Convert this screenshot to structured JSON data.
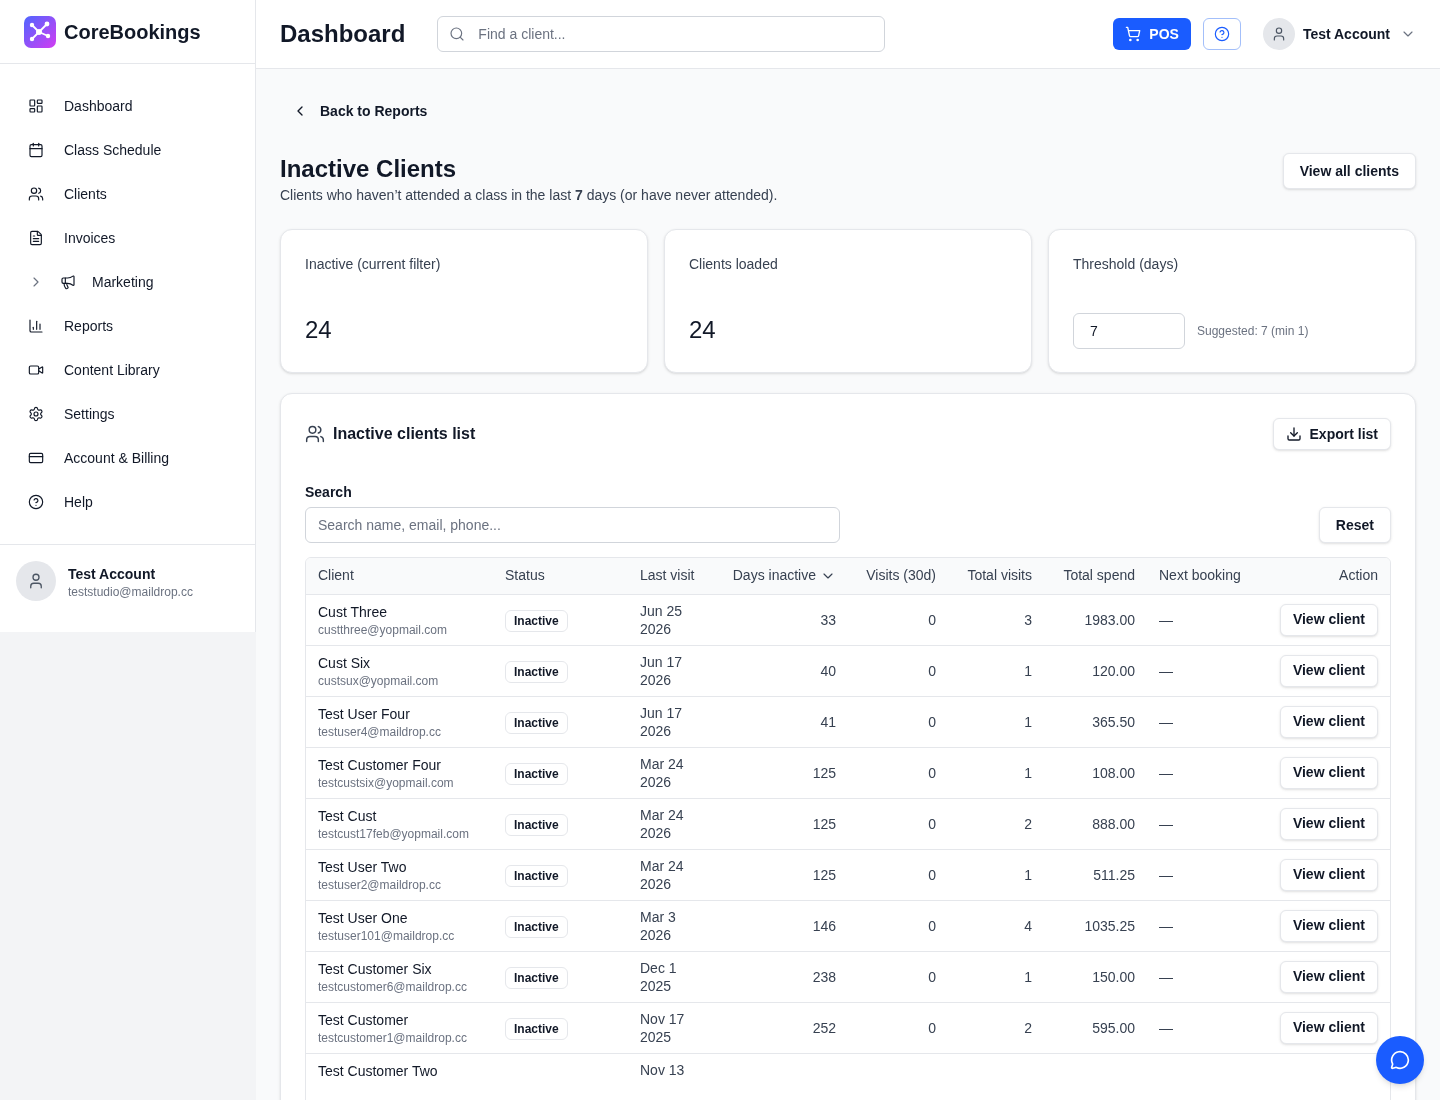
{
  "sidebar": {
    "brand": "CoreBookings",
    "items": [
      {
        "label": "Dashboard",
        "kind": "link",
        "selected": false
      },
      {
        "label": "Class Schedule",
        "kind": "link",
        "selected": false
      },
      {
        "label": "Clients",
        "kind": "link",
        "selected": false
      },
      {
        "label": "Invoices",
        "kind": "link",
        "selected": false
      },
      {
        "label": "Marketing",
        "kind": "group",
        "expanded": false,
        "selected": false
      },
      {
        "label": "Reports",
        "kind": "link",
        "selected": false
      },
      {
        "label": "Content Library",
        "kind": "link",
        "selected": false
      },
      {
        "label": "Settings",
        "kind": "link",
        "selected": false
      },
      {
        "label": "Account & Billing",
        "kind": "link",
        "selected": false
      },
      {
        "label": "Help",
        "kind": "link",
        "selected": false
      }
    ],
    "account": {
      "name": "Test Account",
      "email": "teststudio@maildrop.cc"
    }
  },
  "top_bar": {
    "title": "Dashboard",
    "search": {
      "placeholder": "Find a client..."
    },
    "pos_button": "POS",
    "account": {
      "name": "Test Account"
    }
  },
  "page": {
    "back_link": "Back to Reports",
    "title": "Inactive Clients",
    "subtitle": "Clients who haven’t attended a class in the last **7** days (or have never attended).",
    "view_all_button": "View all clients"
  },
  "stats": [
    {
      "kind": "value",
      "label": "Inactive (current filter)",
      "value": "24"
    },
    {
      "kind": "value",
      "label": "Clients loaded",
      "value": "24"
    },
    {
      "kind": "input",
      "label": "Threshold (days)",
      "value": "7",
      "hint": "Suggested: 7 (min 1)"
    }
  ],
  "clients_list": {
    "title": "Inactive clients list",
    "export_button": "Export list",
    "search": {
      "label": "Search",
      "placeholder": "Search name, email, phone..."
    },
    "reset_button": "Reset",
    "columns": [
      {
        "label": "Client",
        "sorted": false
      },
      {
        "label": "Status",
        "sorted": false
      },
      {
        "label": "Last visit",
        "sorted": false
      },
      {
        "label": "Days inactive",
        "sorted": true
      },
      {
        "label": "Visits (30d)",
        "sorted": false
      },
      {
        "label": "Total visits",
        "sorted": false
      },
      {
        "label": "Total spend",
        "sorted": false
      },
      {
        "label": "Next booking",
        "sorted": false
      },
      {
        "label": "Action",
        "sorted": false
      }
    ],
    "rows": [
      {
        "client": "Cust Three",
        "email": "custthree@yopmail.com",
        "status": "Inactive",
        "last_visit": "Jun 25 2026",
        "days_inactive": "33",
        "visits_30d": "0",
        "total_visits": "3",
        "total_spend": "1983.00",
        "next_booking": "—",
        "action": "View client"
      },
      {
        "client": "Cust Six",
        "email": "custsux@yopmail.com",
        "status": "Inactive",
        "last_visit": "Jun 17 2026",
        "days_inactive": "40",
        "visits_30d": "0",
        "total_visits": "1",
        "total_spend": "120.00",
        "next_booking": "—",
        "action": "View client"
      },
      {
        "client": "Test User Four",
        "email": "testuser4@maildrop.cc",
        "status": "Inactive",
        "last_visit": "Jun 17 2026",
        "days_inactive": "41",
        "visits_30d": "0",
        "total_visits": "1",
        "total_spend": "365.50",
        "next_booking": "—",
        "action": "View client"
      },
      {
        "client": "Test Customer Four",
        "email": "testcustsix@yopmail.com",
        "status": "Inactive",
        "last_visit": "Mar 24 2026",
        "days_inactive": "125",
        "visits_30d": "0",
        "total_visits": "1",
        "total_spend": "108.00",
        "next_booking": "—",
        "action": "View client"
      },
      {
        "client": "Test Cust",
        "email": "testcust17feb@yopmail.com",
        "status": "Inactive",
        "last_visit": "Mar 24 2026",
        "days_inactive": "125",
        "visits_30d": "0",
        "total_visits": "2",
        "total_spend": "888.00",
        "next_booking": "—",
        "action": "View client"
      },
      {
        "client": "Test User Two",
        "email": "testuser2@maildrop.cc",
        "status": "Inactive",
        "last_visit": "Mar 24 2026",
        "days_inactive": "125",
        "visits_30d": "0",
        "total_visits": "1",
        "total_spend": "511.25",
        "next_booking": "—",
        "action": "View client"
      },
      {
        "client": "Test User One",
        "email": "testuser101@maildrop.cc",
        "status": "Inactive",
        "last_visit": "Mar 3 2026",
        "days_inactive": "146",
        "visits_30d": "0",
        "total_visits": "4",
        "total_spend": "1035.25",
        "next_booking": "—",
        "action": "View client"
      },
      {
        "client": "Test Customer Six",
        "email": "testcustomer6@maildrop.cc",
        "status": "Inactive",
        "last_visit": "Dec 1 2025",
        "days_inactive": "238",
        "visits_30d": "0",
        "total_visits": "1",
        "total_spend": "150.00",
        "next_booking": "—",
        "action": "View client"
      },
      {
        "client": "Test Customer",
        "email": "testcustomer1@maildrop.cc",
        "status": "Inactive",
        "last_visit": "Nov 17 2025",
        "days_inactive": "252",
        "visits_30d": "0",
        "total_visits": "2",
        "total_spend": "595.00",
        "next_booking": "—",
        "action": "View client"
      },
      {
        "client": "Test Customer Two",
        "last_visit": "Nov 13"
      }
    ]
  }
}
